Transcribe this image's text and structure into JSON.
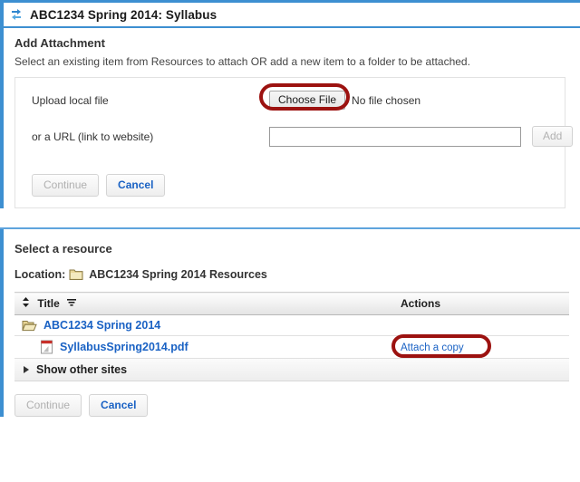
{
  "header": {
    "icon": "sync-arrows-icon",
    "site_title": "ABC1234 Spring 2014: Syllabus"
  },
  "add_attachment": {
    "heading": "Add Attachment",
    "instructions": "Select an existing item from Resources to attach OR add a new item to a folder to be attached.",
    "upload_label": "Upload local file",
    "choose_file_label": "Choose File",
    "no_file_text": "No file chosen",
    "url_label": "or a URL (link to website)",
    "url_value": "",
    "url_placeholder": "",
    "add_label": "Add",
    "continue_label": "Continue",
    "cancel_label": "Cancel"
  },
  "select_resource": {
    "heading": "Select a resource",
    "location_label": "Location:",
    "location_value": "ABC1234 Spring 2014 Resources",
    "columns": {
      "title": "Title",
      "actions": "Actions"
    },
    "rows": [
      {
        "icon": "folder-open-icon",
        "title": "ABC1234 Spring 2014",
        "indent": 1,
        "action": ""
      },
      {
        "icon": "pdf-file-icon",
        "title": "SyllabusSpring2014.pdf",
        "indent": 2,
        "action": "Attach a copy"
      }
    ],
    "show_other_sites": "Show other sites",
    "continue_label": "Continue",
    "cancel_label": "Cancel"
  },
  "annotations": {
    "highlight_color": "#9c1210",
    "targets": [
      "Choose File",
      "Attach a copy"
    ]
  },
  "colors": {
    "accent_blue": "#3d8fd1",
    "link_blue": "#1a62c4",
    "divider_blue": "#5fa4dd",
    "highlight_red": "#9c1210",
    "folder_yellow": "#e8d596"
  }
}
